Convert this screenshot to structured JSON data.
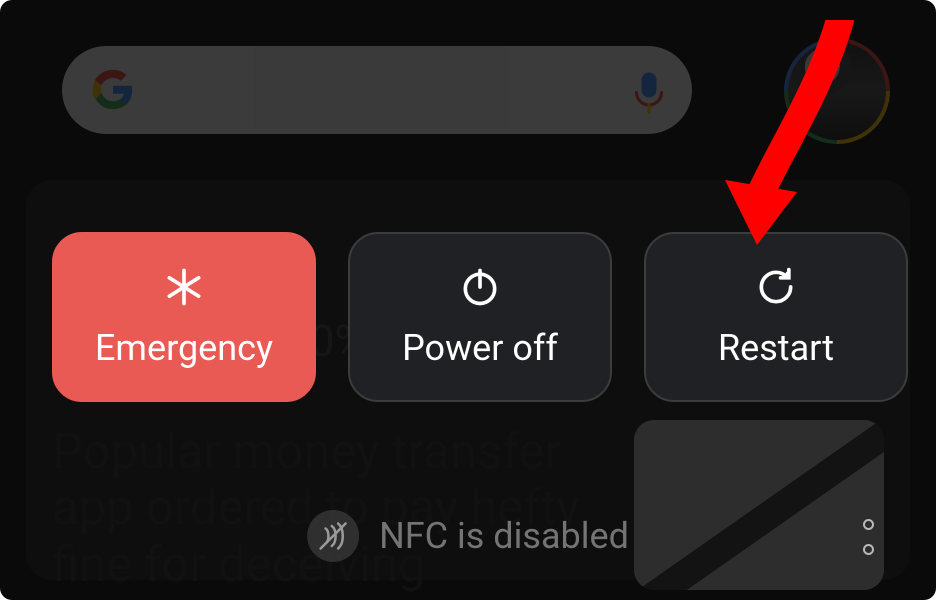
{
  "background": {
    "battery_percent": "30%",
    "headline": "Popular money transfer app ordered to pay hefty fine for deceiving"
  },
  "power_menu": {
    "buttons": [
      {
        "key": "emergency",
        "label": "Emergency",
        "icon": "asterisk-icon",
        "style": "red"
      },
      {
        "key": "power_off",
        "label": "Power off",
        "icon": "power-icon",
        "style": "dark"
      },
      {
        "key": "restart",
        "label": "Restart",
        "icon": "restart-icon",
        "style": "dark"
      }
    ]
  },
  "toast": {
    "message": "NFC is disabled"
  },
  "annotation": {
    "target": "restart",
    "color": "#ff0000"
  }
}
